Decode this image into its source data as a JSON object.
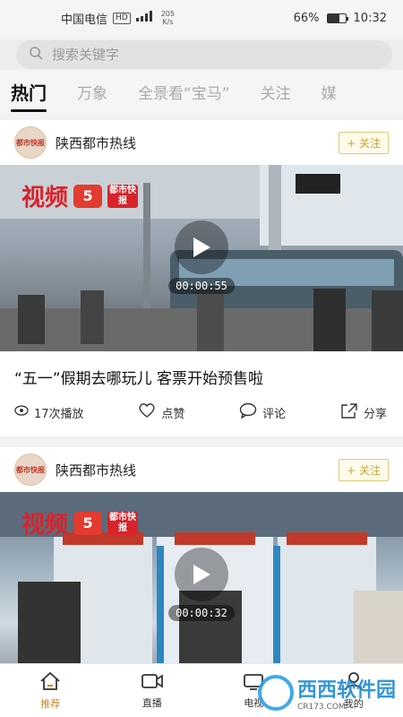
{
  "status": {
    "carrier": "中国电信",
    "hd": "HD",
    "net_speed": "205",
    "net_unit": "K/s",
    "battery": "66%",
    "battery_level": 0.66,
    "time": "10:32"
  },
  "search": {
    "placeholder": "搜索关键字"
  },
  "tabs": [
    {
      "label": "热门",
      "active": true
    },
    {
      "label": "万象"
    },
    {
      "label": "全景看“宝马”"
    },
    {
      "label": "关注"
    },
    {
      "label": "媒"
    }
  ],
  "cards": [
    {
      "author": "陕西都市热线",
      "follow_label": "+ 关注",
      "logo": {
        "text": "视频",
        "badge": "5",
        "news": "都市快报"
      },
      "duration": "00:00:55",
      "title": "“五一”假期去哪玩儿 客票开始预售啦",
      "plays": "17次播放",
      "like": "点赞",
      "comment": "评论",
      "share": "分享"
    },
    {
      "author": "陕西都市热线",
      "follow_label": "+ 关注",
      "logo": {
        "text": "视频",
        "badge": "5",
        "news": "都市快报"
      },
      "duration": "00:00:32"
    }
  ],
  "nav": [
    {
      "label": "推荐",
      "icon": "home-icon",
      "active": true
    },
    {
      "label": "直播",
      "icon": "video-camera-icon"
    },
    {
      "label": "电视",
      "icon": "tv-icon"
    },
    {
      "label": "我的",
      "icon": "profile-icon"
    }
  ],
  "watermark": {
    "text": "西西软件园",
    "sub": "CR173.COM"
  },
  "colors": {
    "accent": "#c88a1e",
    "logo_red": "#d8232a"
  }
}
